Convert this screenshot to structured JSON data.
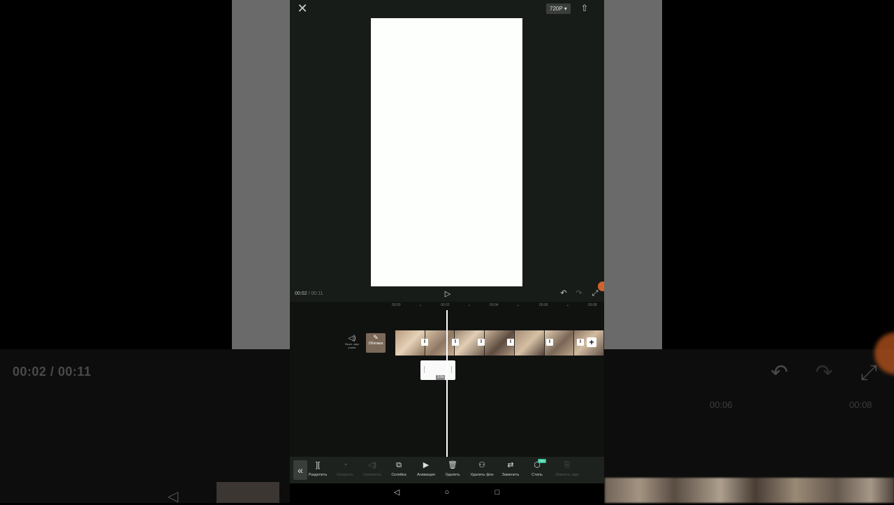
{
  "background": {
    "timecode": "00:02 / 00:11",
    "ticks": [
      "00:06",
      "00:08"
    ]
  },
  "header": {
    "resolution": "720P ▾"
  },
  "player": {
    "current_time": "00:02",
    "total_time": " / 00:11"
  },
  "ruler": {
    "ticks": [
      "00:00",
      "00:02",
      "00:04",
      "00:06",
      "00:08"
    ]
  },
  "track": {
    "audio_label": "Выкл. звук клипа",
    "cover_label": "Обложка",
    "sticker_duration": "3.0s"
  },
  "toolbar": {
    "items": [
      {
        "label": "Разделить",
        "icon": "split-icon",
        "enabled": true
      },
      {
        "label": "Скорость",
        "icon": "speed-icon",
        "enabled": false
      },
      {
        "label": "Громкость",
        "icon": "volume-icon",
        "enabled": false
      },
      {
        "label": "Склейка",
        "icon": "overlay-icon",
        "enabled": true
      },
      {
        "label": "Анимация",
        "icon": "animation-icon",
        "enabled": true
      },
      {
        "label": "Удалить",
        "icon": "trash-icon",
        "enabled": true
      },
      {
        "label": "Удалить фон",
        "icon": "remove-bg-icon",
        "enabled": true
      },
      {
        "label": "Заменить",
        "icon": "replace-icon",
        "enabled": true
      },
      {
        "label": "Стиль",
        "icon": "style-icon",
        "enabled": true,
        "badge": "New"
      },
      {
        "label": "Извлечь звук",
        "icon": "extract-audio-icon",
        "enabled": false
      }
    ]
  },
  "colors": {
    "editor_bg": "#181c18",
    "canvas": "#fcfffb",
    "accent_badge": "#3cc8a0"
  }
}
